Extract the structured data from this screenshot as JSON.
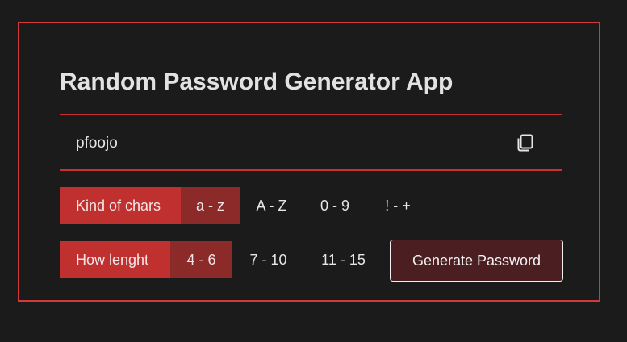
{
  "app": {
    "title": "Random Password Generator App"
  },
  "password": {
    "value": "pfoojo",
    "copy_icon": "copy-icon"
  },
  "chars": {
    "label": "Kind of chars",
    "options": [
      "a - z",
      "A - Z",
      "0 - 9",
      "! - +"
    ],
    "selected": "a - z"
  },
  "length": {
    "label": "How lenght",
    "options": [
      "4 - 6",
      "7 - 10",
      "11 - 15"
    ],
    "selected": "4 - 6"
  },
  "actions": {
    "generate_label": "Generate Password"
  },
  "colors": {
    "background": "#1b1b1b",
    "accent": "#c0302f",
    "accent_active": "#8c2a2a",
    "button_bg": "#4b1f21",
    "frame_border": "#d23a3a"
  }
}
